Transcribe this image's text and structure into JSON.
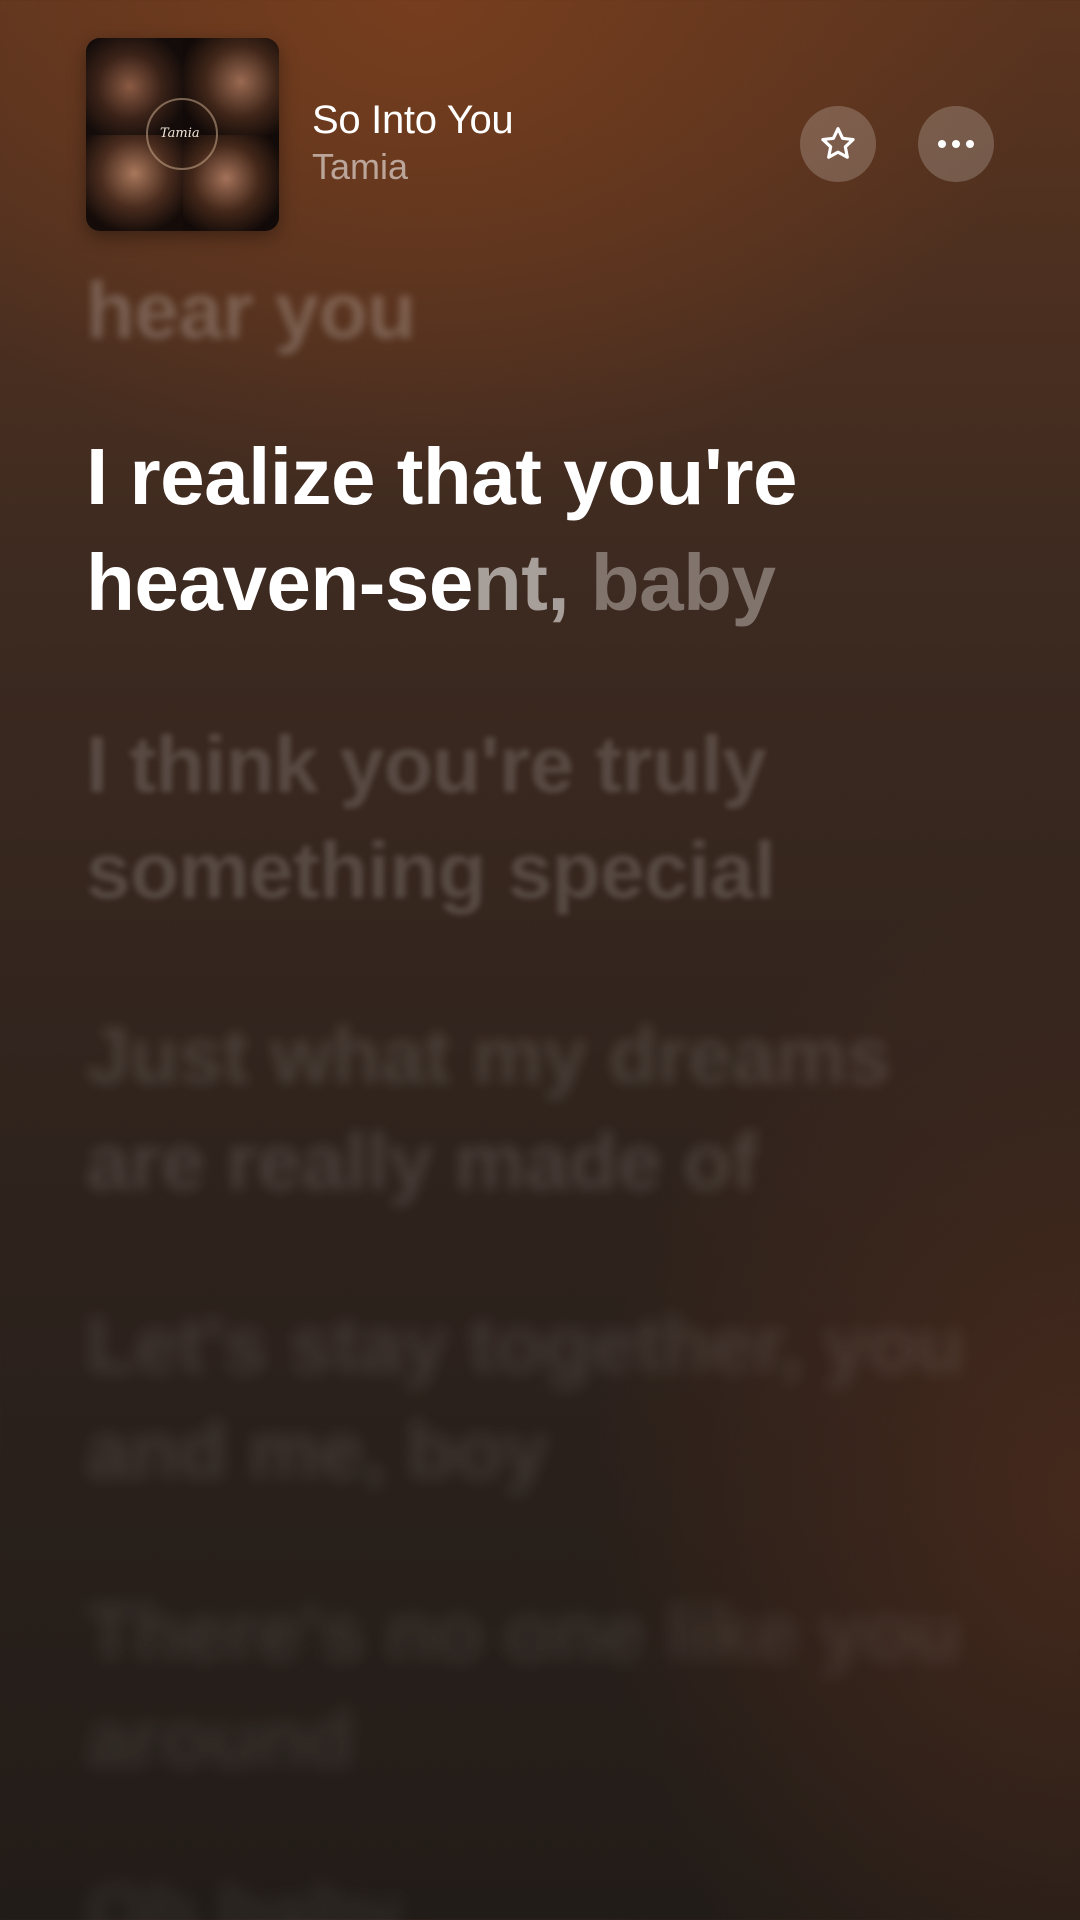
{
  "now_playing": {
    "title": "So Into You",
    "artist": "Tamia",
    "album_art_text": "Tamia"
  },
  "actions": {
    "favorite_icon": "star-outline-icon",
    "more_icon": "ellipsis-icon"
  },
  "lyrics": {
    "previous": "hear you",
    "current_line1": "I realize that you're",
    "current_line2_sung": "heaven-se",
    "current_line2_fade": "nt,",
    "current_line2_unsung": " baby",
    "upcoming": [
      "I think you're truly something special",
      "Just what my dreams are really made of",
      "Let's stay together, you and me, boy",
      "There's no one like you around",
      "Oh baby"
    ]
  },
  "colors": {
    "background_top": "#5a341f",
    "background_bottom": "#221c18",
    "active_lyric": "#ffffff"
  }
}
